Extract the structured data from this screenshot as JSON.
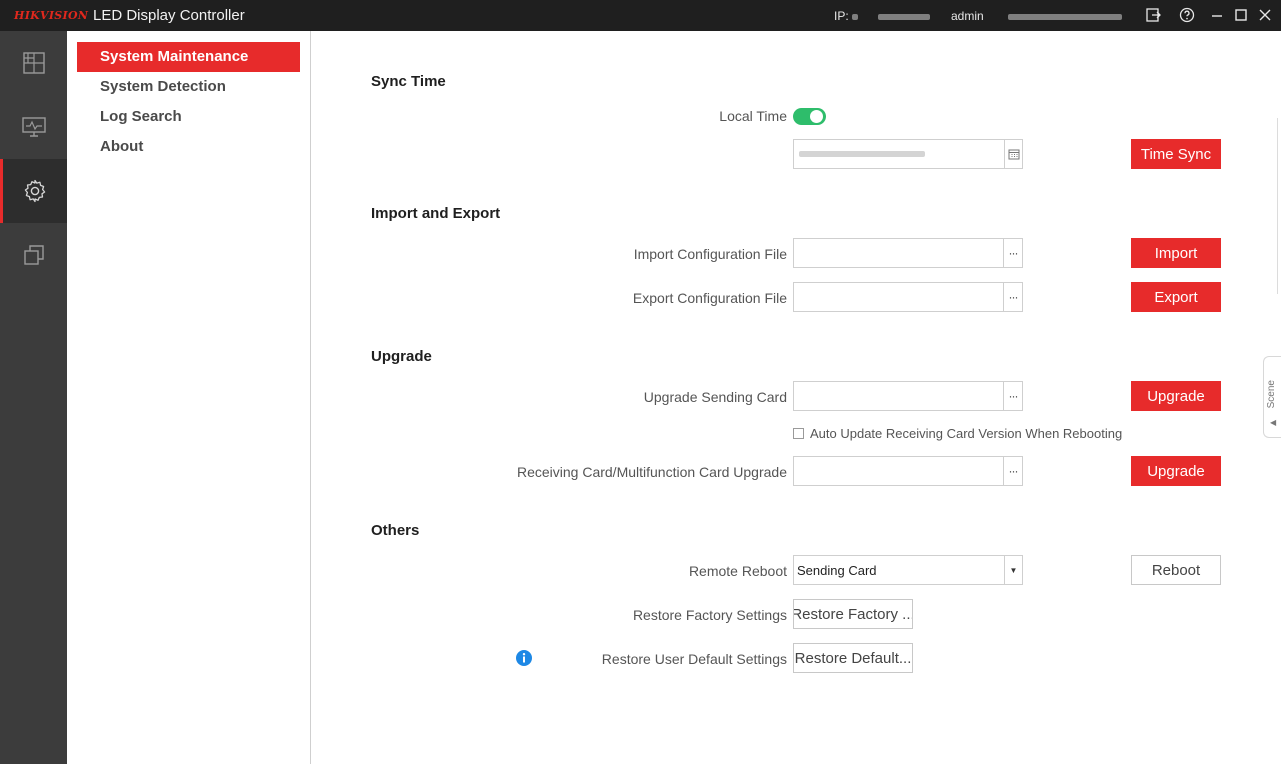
{
  "app": {
    "brand": "HIKVISION",
    "title": "LED Display Controller",
    "ip_label": "IP:",
    "user": "admin"
  },
  "colors": {
    "accent": "#e72b2b",
    "toggle_on": "#2ebd6b",
    "titlebar": "#1f1f1f",
    "rail": "#3c3c3c"
  },
  "rail": {
    "items": [
      {
        "icon": "layout-grid-icon",
        "active": false
      },
      {
        "icon": "monitor-chart-icon",
        "active": false
      },
      {
        "icon": "gear-icon",
        "active": true
      },
      {
        "icon": "windows-copy-icon",
        "active": false
      }
    ]
  },
  "subnav": {
    "items": [
      {
        "label": "System Maintenance",
        "active": true
      },
      {
        "label": "System Detection",
        "active": false
      },
      {
        "label": "Log Search",
        "active": false
      },
      {
        "label": "About",
        "active": false
      }
    ]
  },
  "sync_time": {
    "title": "Sync Time",
    "local_time_label": "Local Time",
    "local_time_on": true,
    "time_sync_button": "Time Sync"
  },
  "import_export": {
    "title": "Import and Export",
    "import_label": "Import Configuration File",
    "import_button": "Import",
    "export_label": "Export Configuration File",
    "export_button": "Export"
  },
  "upgrade": {
    "title": "Upgrade",
    "sending_card_label": "Upgrade Sending Card",
    "sending_card_button": "Upgrade",
    "auto_update_label": "Auto Update Receiving Card Version When Rebooting",
    "auto_update_checked": false,
    "receiving_card_label": "Receiving Card/Multifunction Card Upgrade",
    "receiving_card_button": "Upgrade"
  },
  "others": {
    "title": "Others",
    "remote_reboot_label": "Remote Reboot",
    "remote_reboot_value": "Sending Card",
    "reboot_button": "Reboot",
    "restore_factory_label": "Restore Factory Settings",
    "restore_factory_button": "Restore Factory ...",
    "restore_user_label": "Restore User Default Settings",
    "restore_user_button": "Restore Default..."
  },
  "side_tab": {
    "label": "Scene"
  }
}
